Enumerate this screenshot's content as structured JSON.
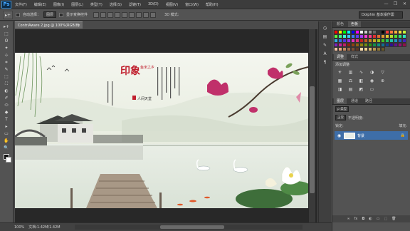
{
  "app": {
    "logo": "Ps"
  },
  "menu": [
    "文件(F)",
    "编辑(E)",
    "图像(I)",
    "图层(L)",
    "类型(Y)",
    "选择(S)",
    "滤镜(T)",
    "3D(D)",
    "视图(V)",
    "窗口(W)",
    "帮助(H)"
  ],
  "window_controls": [
    "—",
    "❐",
    "✕"
  ],
  "options": {
    "auto_select_label": "自动选择：",
    "auto_select_value": "图层",
    "show_transform_label": "显示变换控件",
    "mode3d_label": "3D 模式:",
    "workspace": "Dolphin 基本操作需"
  },
  "document": {
    "tab_title": "ContriAware 2.jpg @ 100%(RGB/8)",
    "close": "×",
    "zoom": "100%",
    "doc_size": "文档:1.42M/1.42M"
  },
  "tools": [
    "▸+",
    "⬚",
    "ʘ",
    "✦",
    "⊹",
    "⌗",
    "✎",
    "⬚",
    "⛶",
    "◐",
    "✐",
    "⬭",
    "◆",
    "T",
    "▸",
    "▭",
    "✋",
    "🔍"
  ],
  "panels": {
    "color_tabs": [
      "颜色",
      "色板"
    ],
    "adjust_tabs": [
      "调整",
      "样式"
    ],
    "adjust_title": "添加调整",
    "layer_tabs": [
      "图层",
      "通道",
      "路径"
    ],
    "kind_label": "ρ 类型",
    "normal_label": "正常",
    "opacity_label": "不透明度:",
    "lock_label": "锁定:",
    "fill_label": "填充:",
    "layer_name": "背景",
    "footer_icons": [
      "∞",
      "fx",
      "◘",
      "◐",
      "▭",
      "⬚",
      "🗑"
    ]
  },
  "swatch_colors": [
    "#ff0000",
    "#ffff00",
    "#00ff00",
    "#00ffff",
    "#0000ff",
    "#ff00ff",
    "#ffffff",
    "#cccccc",
    "#999999",
    "#666666",
    "#333333",
    "#000000",
    "#ff3b3b",
    "#ff7a3b",
    "#ffb23b",
    "#ffe23b",
    "#c8ff3b",
    "#5cff3b",
    "#3bff8c",
    "#3bffd8",
    "#3bc6ff",
    "#3b7aff",
    "#5c3bff",
    "#a83bff",
    "#ff3bd6",
    "#ff3b8c",
    "#e03030",
    "#e06a30",
    "#e09a30",
    "#e0c830",
    "#b0e030",
    "#50e030",
    "#30e07a",
    "#30e0c0",
    "#30aee0",
    "#306ae0",
    "#5030e0",
    "#9430e0",
    "#e030bc",
    "#e0307a",
    "#c02020",
    "#c05a20",
    "#c08420",
    "#c0ac20",
    "#98c020",
    "#44c020",
    "#20c068",
    "#20c0a6",
    "#2096c0",
    "#205ac0",
    "#4420c0",
    "#8020c0",
    "#c020a2",
    "#c02068",
    "#902010",
    "#904010",
    "#906010",
    "#908010",
    "#709010",
    "#309010",
    "#10904c",
    "#10907c",
    "#107090",
    "#104090",
    "#301090",
    "#601090",
    "#901078",
    "#90104c",
    "#f4c6a8",
    "#e8a880",
    "#c68a62",
    "#a06a48",
    "#7a4e34",
    "#5a3826",
    "#ffe0b0",
    "#f0d090",
    "#d8b870",
    "#b89850",
    "#907838",
    "#685828"
  ],
  "art": {
    "title_main": "印象",
    "subtitle": "鱼米之乡",
    "caption": "人间天堂"
  },
  "colors": {
    "accent": "#3e6ea8",
    "logo_blue": "#42a5ff"
  }
}
